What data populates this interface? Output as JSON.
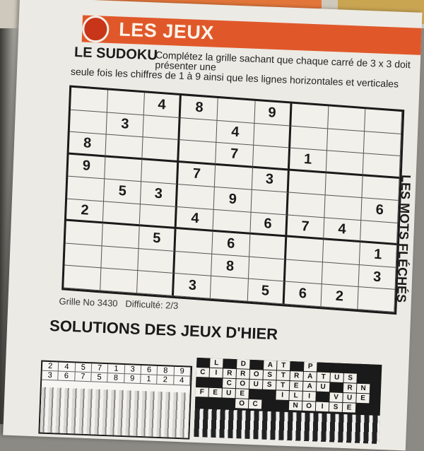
{
  "banner": {
    "title": "LES JEUX"
  },
  "sudoku": {
    "title": "LE SUDOKU",
    "instructions_1": "Complétez la grille sachant que chaque carré de 3 x 3 doit présenter une",
    "instructions_2": "seule fois les chiffres de 1 à 9 ainsi que les lignes horizontales et verticales",
    "grid": [
      [
        "",
        "",
        "4",
        "8",
        "",
        "9",
        "",
        "",
        ""
      ],
      [
        "",
        "3",
        "",
        "",
        "4",
        "",
        "",
        "",
        ""
      ],
      [
        "8",
        "",
        "",
        "",
        "7",
        "",
        "1",
        "",
        ""
      ],
      [
        "9",
        "",
        "",
        "7",
        "",
        "3",
        "",
        "",
        ""
      ],
      [
        "",
        "5",
        "3",
        "",
        "9",
        "",
        "",
        "",
        "6"
      ],
      [
        "2",
        "",
        "",
        "4",
        "",
        "6",
        "7",
        "4",
        ""
      ],
      [
        "",
        "",
        "5",
        "",
        "6",
        "",
        "",
        "",
        "1"
      ],
      [
        "",
        "",
        "",
        "",
        "8",
        "",
        "",
        "",
        "3"
      ],
      [
        "",
        "",
        "",
        "3",
        "",
        "5",
        "6",
        "2",
        ""
      ]
    ],
    "grid_no": "Grille No 3430",
    "difficulty": "Difficulté: 2/3"
  },
  "solutions": {
    "title": "SOLUTIONS DES JEUX D'HIER",
    "sudoku_rows": [
      [
        "2",
        "4",
        "5",
        "7",
        "1",
        "3",
        "6",
        "8",
        "9"
      ],
      [
        "3",
        "6",
        "7",
        "5",
        "8",
        "9",
        "1",
        "2",
        "4"
      ]
    ],
    "crossword_rows": [
      [
        "",
        "L",
        "",
        "D",
        "",
        "A",
        "T",
        "",
        "P",
        "",
        "",
        "",
        ""
      ],
      [
        "C",
        "I",
        "R",
        "R",
        "O",
        "S",
        "T",
        "R",
        "A",
        "T",
        "U",
        "S",
        ""
      ],
      [
        "",
        "",
        "C",
        "O",
        "U",
        "S",
        "T",
        "E",
        "A",
        "U",
        "",
        "R",
        "N"
      ],
      [
        "F",
        "E",
        "U",
        "E",
        "",
        "",
        "I",
        "L",
        "I",
        "",
        "V",
        "U",
        "E"
      ],
      [
        "",
        "",
        "",
        "O",
        "C",
        "",
        "",
        "N",
        "O",
        "I",
        "S",
        "E",
        ""
      ]
    ]
  },
  "side_title": "LES MOTS FLÉCHÉS"
}
